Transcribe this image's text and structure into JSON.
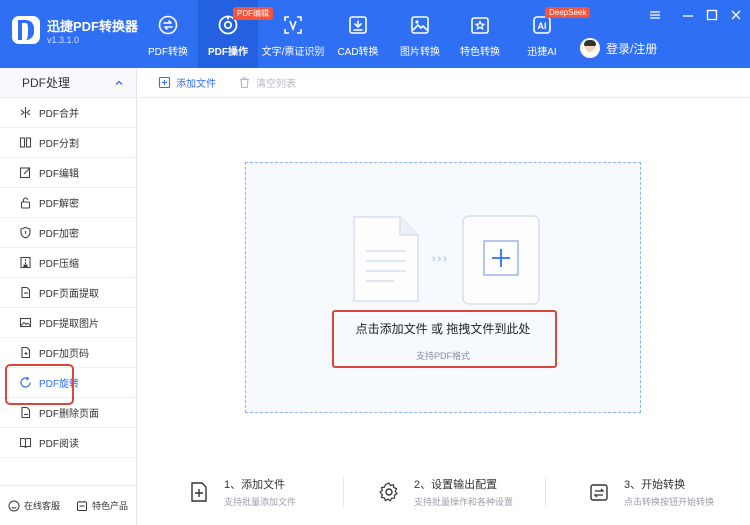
{
  "app": {
    "name": "迅捷PDF转换器",
    "version": "v1.3.1.0"
  },
  "colors": {
    "brand": "#2f6ff4",
    "active_nav": "#2461e0",
    "badge": "#f2543d",
    "highlight": "#d9473c"
  },
  "nav": [
    {
      "label": "PDF转换",
      "icon": "convert-icon"
    },
    {
      "label": "PDF操作",
      "icon": "pdf-ops-icon",
      "active": true,
      "badge": "PDF编辑"
    },
    {
      "label": "文字/票证识别",
      "icon": "ocr-icon"
    },
    {
      "label": "CAD转换",
      "icon": "cad-icon"
    },
    {
      "label": "图片转换",
      "icon": "image-icon"
    },
    {
      "label": "特色转换",
      "icon": "star-icon"
    },
    {
      "label": "迅捷AI",
      "icon": "ai-icon",
      "badge": "DeepSeek"
    }
  ],
  "user": {
    "label": "登录/注册"
  },
  "sidebar": {
    "header": "PDF处理",
    "items": [
      {
        "label": "PDF合并",
        "icon": "merge-icon"
      },
      {
        "label": "PDF分割",
        "icon": "split-icon"
      },
      {
        "label": "PDF编辑",
        "icon": "edit-icon"
      },
      {
        "label": "PDF解密",
        "icon": "unlock-icon"
      },
      {
        "label": "PDF加密",
        "icon": "shield-icon"
      },
      {
        "label": "PDF压缩",
        "icon": "compress-icon"
      },
      {
        "label": "PDF页面提取",
        "icon": "page-extract-icon"
      },
      {
        "label": "PDF提取图片",
        "icon": "picture-icon"
      },
      {
        "label": "PDF加页码",
        "icon": "page-number-icon"
      },
      {
        "label": "PDF旋转",
        "icon": "rotate-icon",
        "active": true
      },
      {
        "label": "PDF删除页面",
        "icon": "delete-page-icon"
      },
      {
        "label": "PDF阅读",
        "icon": "read-icon"
      }
    ],
    "footer": {
      "support": "在线客服",
      "featured": "特色产品"
    }
  },
  "toolbar": {
    "add_file": "添加文件",
    "clear_list": "清空列表"
  },
  "dropzone": {
    "title": "点击添加文件 或 拖拽文件到此处",
    "subtitle": "支持PDF格式"
  },
  "steps": [
    {
      "title": "1、添加文件",
      "desc": "支持批量添加文件"
    },
    {
      "title": "2、设置输出配置",
      "desc": "支持批量操作和各种设置"
    },
    {
      "title": "3、开始转换",
      "desc": "点击转换按钮开始转换"
    }
  ]
}
